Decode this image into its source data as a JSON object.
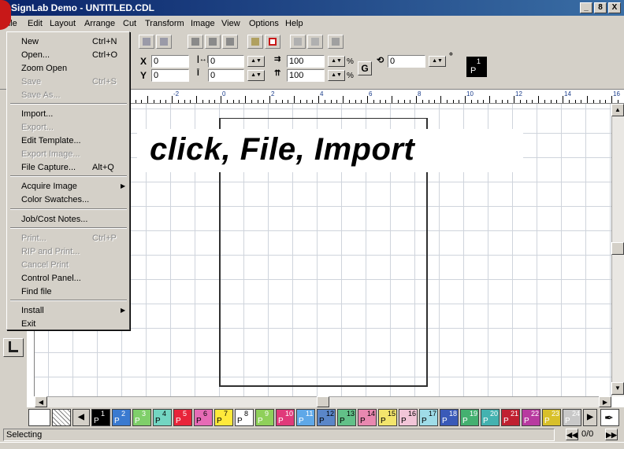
{
  "window": {
    "title": "SignLab Demo - UNTITLED.CDL",
    "minimize": "_",
    "maximize": "8",
    "close": "X"
  },
  "menubar": [
    "File",
    "Edit",
    "Layout",
    "Arrange",
    "Cut",
    "Transform",
    "Image",
    "View",
    "Options",
    "Help"
  ],
  "file_menu": {
    "items": [
      {
        "label": "New",
        "shortcut": "Ctrl+N",
        "enabled": true
      },
      {
        "label": "Open...",
        "shortcut": "Ctrl+O",
        "enabled": true
      },
      {
        "label": "Zoom Open",
        "shortcut": "",
        "enabled": true
      },
      {
        "label": "Save",
        "shortcut": "Ctrl+S",
        "enabled": false
      },
      {
        "label": "Save As...",
        "shortcut": "",
        "enabled": false
      },
      {
        "label": "Import...",
        "shortcut": "",
        "enabled": true
      },
      {
        "label": "Export...",
        "shortcut": "",
        "enabled": false
      },
      {
        "label": "Edit Template...",
        "shortcut": "",
        "enabled": true
      },
      {
        "label": "Export Image...",
        "shortcut": "",
        "enabled": false
      },
      {
        "label": "File Capture...",
        "shortcut": "Alt+Q",
        "enabled": true
      },
      {
        "label": "Acquire Image",
        "shortcut": "",
        "enabled": true,
        "submenu": true
      },
      {
        "label": "Color Swatches...",
        "shortcut": "",
        "enabled": true
      },
      {
        "label": "Job/Cost Notes...",
        "shortcut": "",
        "enabled": true
      },
      {
        "label": "Print...",
        "shortcut": "Ctrl+P",
        "enabled": false
      },
      {
        "label": "RIP and Print...",
        "shortcut": "",
        "enabled": false
      },
      {
        "label": "Cancel Print",
        "shortcut": "",
        "enabled": false
      },
      {
        "label": "Control Panel...",
        "shortcut": "",
        "enabled": true
      },
      {
        "label": "Find file",
        "shortcut": "",
        "enabled": true
      },
      {
        "label": "Install",
        "shortcut": "",
        "enabled": true,
        "submenu": true
      },
      {
        "label": "Exit",
        "shortcut": "",
        "enabled": true
      }
    ]
  },
  "properties": {
    "x_label": "X",
    "x_value": "0",
    "y_label": "Y",
    "y_value": "0",
    "width_value": "0",
    "height_value": "0",
    "scale_x": "100",
    "scale_y": "100",
    "percent": "%",
    "rotation": "0",
    "degree": "°",
    "g_button": "G",
    "page_chip": "P",
    "page_chip_num": "1"
  },
  "ruler_labels": [
    "-2",
    "0",
    "2",
    "4",
    "6",
    "8",
    "10",
    "12",
    "14",
    "16"
  ],
  "caption": "click, File, Import",
  "palette": {
    "swatches": [
      {
        "num": "1",
        "color": "#000000",
        "text": "#ffffff"
      },
      {
        "num": "2",
        "color": "#3a7ad0",
        "text": "#ffffff"
      },
      {
        "num": "3",
        "color": "#7fcf6a",
        "text": "#ffffff"
      },
      {
        "num": "4",
        "color": "#73d5c2",
        "text": "#000000"
      },
      {
        "num": "5",
        "color": "#e8243a",
        "text": "#ffffff"
      },
      {
        "num": "6",
        "color": "#e66bb6",
        "text": "#000000"
      },
      {
        "num": "7",
        "color": "#ffe93b",
        "text": "#000000"
      },
      {
        "num": "8",
        "color": "#ffffff",
        "text": "#000000"
      },
      {
        "num": "9",
        "color": "#8fd05a",
        "text": "#ffffff"
      },
      {
        "num": "10",
        "color": "#e03a7a",
        "text": "#ffffff"
      },
      {
        "num": "11",
        "color": "#5fa8e8",
        "text": "#ffffff"
      },
      {
        "num": "12",
        "color": "#5a86c8",
        "text": "#000000"
      },
      {
        "num": "13",
        "color": "#62c088",
        "text": "#000000"
      },
      {
        "num": "14",
        "color": "#e888b0",
        "text": "#000000"
      },
      {
        "num": "15",
        "color": "#f3e56c",
        "text": "#000000"
      },
      {
        "num": "16",
        "color": "#f2c5d8",
        "text": "#000000"
      },
      {
        "num": "17",
        "color": "#9fdce8",
        "text": "#000000"
      },
      {
        "num": "18",
        "color": "#3a5ab8",
        "text": "#ffffff"
      },
      {
        "num": "19",
        "color": "#44b070",
        "text": "#ffffff"
      },
      {
        "num": "20",
        "color": "#44b2b0",
        "text": "#ffffff"
      },
      {
        "num": "21",
        "color": "#c02030",
        "text": "#ffffff"
      },
      {
        "num": "22",
        "color": "#b83aa0",
        "text": "#ffffff"
      },
      {
        "num": "23",
        "color": "#d8c02a",
        "text": "#ffffff"
      },
      {
        "num": "24",
        "color": "#c8c8c8",
        "text": "#ffffff"
      }
    ],
    "swatch_label": "P"
  },
  "status": {
    "text": "Selecting",
    "page_count": "0/0"
  },
  "colors": {
    "title_start": "#0a246a",
    "title_end": "#3a6ea5",
    "chrome": "#d4d0c8",
    "accent_red": "#c81818"
  }
}
